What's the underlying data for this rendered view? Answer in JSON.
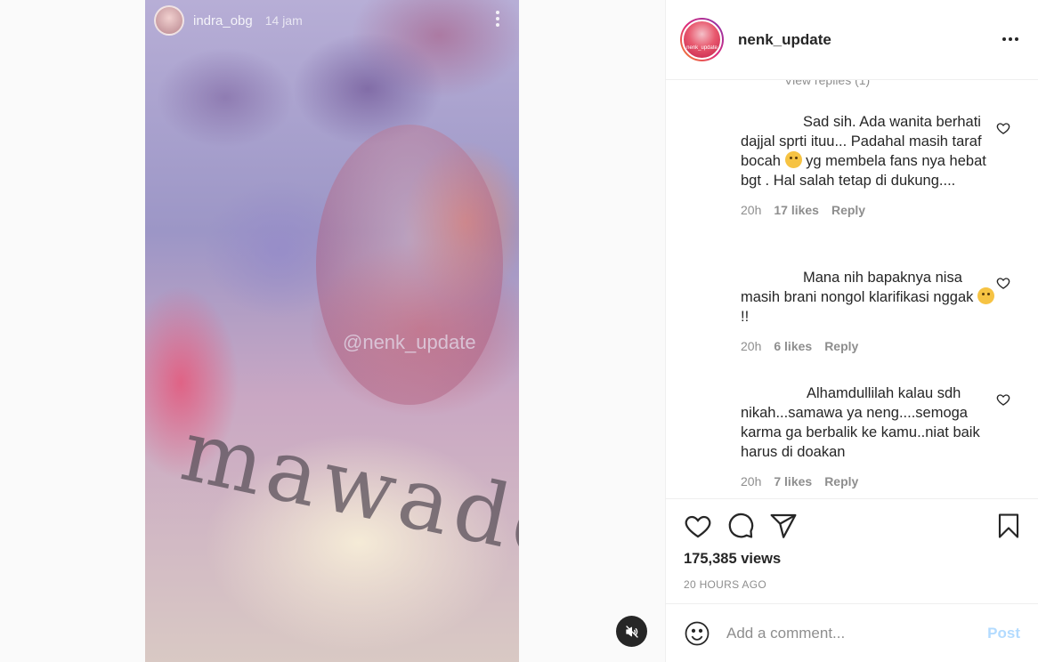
{
  "story": {
    "username": "indra_obg",
    "time": "14 jam",
    "watermark": "@nenk_update",
    "handwriting": "mawadd"
  },
  "header": {
    "username": "nenk_update",
    "avatar_caption": "nenk_update"
  },
  "comments": {
    "view_replies": "View replies (1)",
    "items": [
      {
        "text_before": "Sad sih. Ada wanita berhati dajjal sprti ituu... Padahal masih taraf bocah ",
        "text_after": " yg membela fans nya hebat bgt . Hal salah tetap di dukung....",
        "emoji": "worried-face",
        "time": "20h",
        "likes": "17 likes",
        "reply": "Reply"
      },
      {
        "text_before": "Mana nih bapaknya nisa masih brani nongol klarifikasi nggak ",
        "text_after": " !!",
        "emoji": "grinning-sweat-face",
        "time": "20h",
        "likes": "6 likes",
        "reply": "Reply"
      },
      {
        "text_before": "Alhamdullilah kalau sdh nikah...samawa ya neng....semoga karma ga berbalik ke kamu..niat baik harus di doakan",
        "text_after": "",
        "emoji": "",
        "time": "20h",
        "likes": "7 likes",
        "reply": "Reply"
      }
    ]
  },
  "actions": {
    "icons": [
      "heart-icon",
      "comment-icon",
      "share-icon",
      "bookmark-icon"
    ],
    "views": "175,385 views",
    "date": "20 HOURS AGO"
  },
  "comment_box": {
    "placeholder": "Add a comment...",
    "post_label": "Post"
  },
  "colors": {
    "post_button_disabled": "#b3dbff",
    "meta_text": "#8e8e8e",
    "mute_button": "#262626"
  }
}
